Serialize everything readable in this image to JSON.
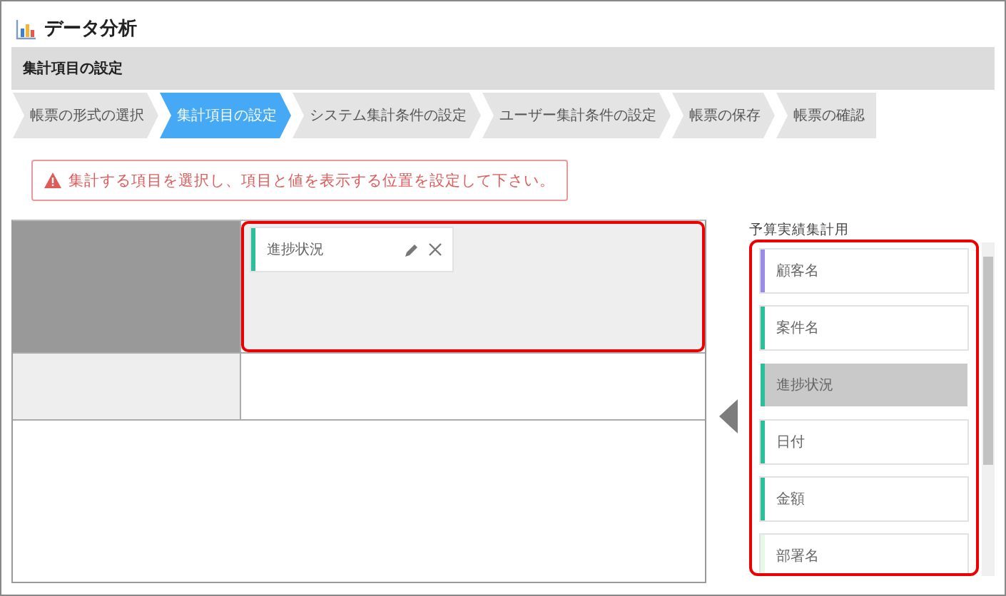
{
  "window": {
    "title": "データ分析"
  },
  "section_header": "集計項目の設定",
  "steps": [
    {
      "label": "帳票の形式の選択",
      "selected": false
    },
    {
      "label": "集計項目の設定",
      "selected": true
    },
    {
      "label": "システム集計条件の設定",
      "selected": false
    },
    {
      "label": "ユーザー集計条件の設定",
      "selected": false
    },
    {
      "label": "帳票の保存",
      "selected": false
    },
    {
      "label": "帳票の確認",
      "selected": false
    }
  ],
  "alert": {
    "text": "集計する項目を選択し、項目と値を表示する位置を設定して下さい。"
  },
  "layout_grid": {
    "placed_items": [
      {
        "label": "進捗状況",
        "color": "#2bbf9c"
      }
    ]
  },
  "field_panel": {
    "title": "予算実績集計用",
    "fields": [
      {
        "label": "顧客名",
        "color": "#9b8be8",
        "selected": false
      },
      {
        "label": "案件名",
        "color": "#2bbf9c",
        "selected": false
      },
      {
        "label": "進捗状況",
        "color": "#2bbf9c",
        "selected": true
      },
      {
        "label": "日付",
        "color": "#2bbf9c",
        "selected": false
      },
      {
        "label": "金額",
        "color": "#2bbf9c",
        "selected": false
      },
      {
        "label": "部署名",
        "color": "#e6f8e6",
        "selected": false
      }
    ]
  }
}
